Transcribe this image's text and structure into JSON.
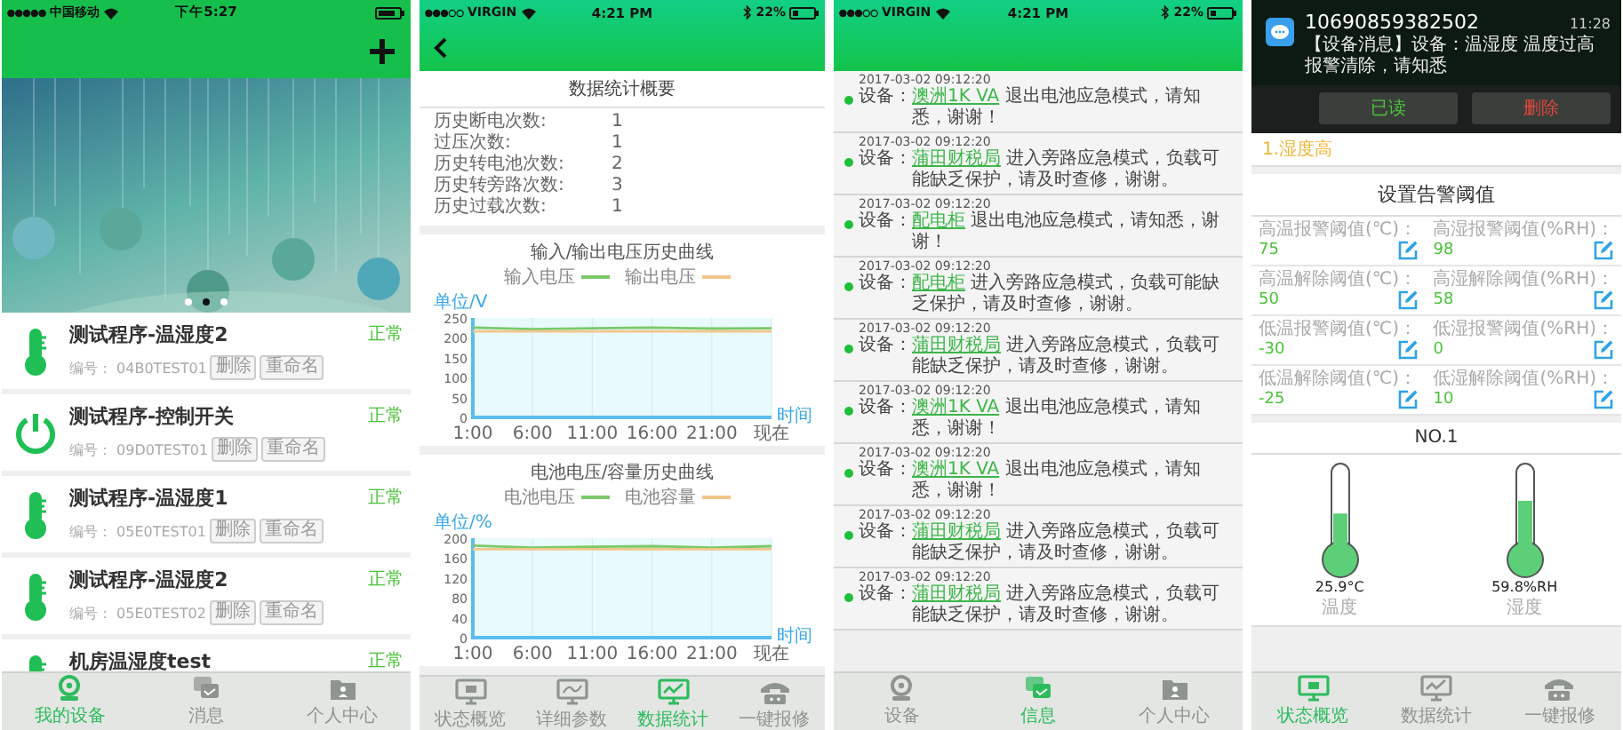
{
  "device_list_screen": {
    "status_bar": {
      "carrier": "中国移动",
      "time": "下午5:27"
    },
    "banner": {
      "dots": [
        {
          "selected": false
        },
        {
          "selected": true
        },
        {
          "selected": false
        }
      ]
    },
    "devices": [
      {
        "kind": "thermometer",
        "name": "测试程序-温湿度2",
        "code": "编号： 04B0TEST01",
        "actions": [
          "删除",
          "重命名"
        ],
        "status": "正常"
      },
      {
        "kind": "power",
        "name": "测试程序-控制开关",
        "code": "编号： 09D0TEST01",
        "actions": [
          "删除",
          "重命名"
        ],
        "status": "正常"
      },
      {
        "kind": "thermometer",
        "name": "测试程序-温湿度1",
        "code": "编号： 05E0TEST01",
        "actions": [
          "删除",
          "重命名"
        ],
        "status": "正常"
      },
      {
        "kind": "thermometer",
        "name": "测试程序-温湿度2",
        "code": "编号： 05E0TEST02",
        "actions": [
          "删除",
          "重命名"
        ],
        "status": "正常"
      },
      {
        "kind": "thermometer",
        "name": "机房温湿度test",
        "status": "正常"
      }
    ],
    "tabs": [
      {
        "kind": "webcam",
        "label": "我的设备",
        "selected": true
      },
      {
        "kind": "chat",
        "label": "消息",
        "selected": false
      },
      {
        "kind": "folder",
        "label": "个人中心",
        "selected": false
      }
    ]
  },
  "statistics_screen": {
    "status_bar": {
      "carrier": "VIRGIN",
      "time": "4:21 PM",
      "battery_percent": "22%"
    },
    "summary": {
      "title": "数据统计概要",
      "rows": [
        {
          "label": "历史断电次数:",
          "value": "1"
        },
        {
          "label": "过压次数:",
          "value": "1"
        },
        {
          "label": "历史转电池次数:",
          "value": "2"
        },
        {
          "label": "历史转旁路次数:",
          "value": "3"
        },
        {
          "label": "历史过载次数:",
          "value": "1"
        }
      ]
    },
    "charts": [
      {
        "chart_data": {
          "type": "line",
          "grid": true,
          "legend": "top",
          "title": "输入/输出电压历史曲线",
          "ylabel": "单位/V",
          "xlabel": "时间",
          "categories": [
            "1:00",
            "6:00",
            "11:00",
            "16:00",
            "21:00",
            "现在"
          ],
          "ylim": [
            0,
            250
          ],
          "yticks": [
            0,
            50,
            100,
            150,
            200,
            250
          ],
          "series": [
            {
              "name": "输入电压",
              "color": "#7cc96a",
              "values": [
                226,
                222,
                224,
                226,
                223,
                224
              ]
            },
            {
              "name": "输出电压",
              "color": "#f2c68a",
              "values": [
                216,
                216,
                216,
                216,
                216,
                216
              ]
            }
          ]
        }
      },
      {
        "chart_data": {
          "type": "line",
          "grid": true,
          "legend": "top",
          "title": "电池电压/容量历史曲线",
          "ylabel": "单位/%",
          "xlabel": "时间",
          "categories": [
            "1:00",
            "6:00",
            "11:00",
            "16:00",
            "21:00",
            "现在"
          ],
          "ylim": [
            0,
            200
          ],
          "yticks": [
            0,
            40,
            80,
            120,
            160,
            200
          ],
          "series": [
            {
              "name": "电池电压",
              "color": "#7cc96a",
              "values": [
                185,
                181,
                183,
                184,
                181,
                184
              ]
            },
            {
              "name": "电池容量",
              "color": "#f2c68a",
              "values": [
                178,
                178,
                178,
                178,
                178,
                178
              ]
            }
          ]
        }
      }
    ],
    "tabs": [
      {
        "kind": "monitor",
        "label": "状态概览",
        "selected": false
      },
      {
        "kind": "monitor-curve",
        "label": "详细参数",
        "selected": false
      },
      {
        "kind": "monitor-chart",
        "label": "数据统计",
        "selected": true
      },
      {
        "kind": "phone",
        "label": "一键报修",
        "selected": false
      }
    ]
  },
  "messages_screen": {
    "status_bar": {
      "carrier": "VIRGIN",
      "time": "4:21 PM",
      "battery_percent": "22%"
    },
    "messages": [
      {
        "time": "2017-03-02 09:12:20",
        "prefix": "设备：",
        "device": "澳洲1K VA",
        "text": " 退出电池应急模式，请知悉，谢谢！"
      },
      {
        "time": "2017-03-02 09:12:20",
        "prefix": "设备：",
        "device": "蒲田财税局",
        "text": " 进入旁路应急模式，负载可能缺乏保护，请及时查修，谢谢。"
      },
      {
        "time": "2017-03-02 09:12:20",
        "prefix": "设备：",
        "device": "配电柜",
        "text": " 退出电池应急模式，请知悉，谢谢！"
      },
      {
        "time": "2017-03-02 09:12:20",
        "prefix": "设备：",
        "device": "配电柜",
        "text": " 进入旁路应急模式，负载可能缺乏保护，请及时查修，谢谢。"
      },
      {
        "time": "2017-03-02 09:12:20",
        "prefix": "设备：",
        "device": "蒲田财税局",
        "text": " 进入旁路应急模式，负载可能缺乏保护，请及时查修，谢谢。"
      },
      {
        "time": "2017-03-02 09:12:20",
        "prefix": "设备：",
        "device": "澳洲1K VA",
        "text": " 退出电池应急模式，请知悉，谢谢！"
      },
      {
        "time": "2017-03-02 09:12:20",
        "prefix": "设备：",
        "device": "澳洲1K VA",
        "text": " 退出电池应急模式，请知悉，谢谢！"
      },
      {
        "time": "2017-03-02 09:12:20",
        "prefix": "设备：",
        "device": "蒲田财税局",
        "text": " 进入旁路应急模式，负载可能缺乏保护，请及时查修，谢谢。"
      },
      {
        "time": "2017-03-02 09:12:20",
        "prefix": "设备：",
        "device": "蒲田财税局",
        "text": " 进入旁路应急模式，负载可能缺乏保护，请及时查修，谢谢。"
      }
    ],
    "tabs": [
      {
        "kind": "webcam",
        "label": "设备",
        "selected": false
      },
      {
        "kind": "chat",
        "label": "信息",
        "selected": true
      },
      {
        "kind": "folder",
        "label": "个人中心",
        "selected": false
      }
    ]
  },
  "alarm_screen": {
    "notification": {
      "sender": "10690859382502",
      "time": "11:28",
      "text": "【设备消息】设备：温湿度 温度过高报警清除，请知悉",
      "actions": [
        {
          "kind": "read",
          "label": "已读"
        },
        {
          "kind": "delete",
          "label": "删除"
        }
      ]
    },
    "alarm": "1.湿度高",
    "thresholds_title": "设置告警阈值",
    "thresholds": [
      {
        "label": "高温报警阈值(℃)：",
        "value": "75"
      },
      {
        "label": "高湿报警阈值(%RH)：",
        "value": "98"
      },
      {
        "label": "高温解除阈值(℃)：",
        "value": "50"
      },
      {
        "label": "高湿解除阈值(%RH)：",
        "value": "58"
      },
      {
        "label": "低温报警阈值(℃)：",
        "value": "-30"
      },
      {
        "label": "低湿报警阈值(%RH)：",
        "value": "0"
      },
      {
        "label": "低温解除阈值(℃)：",
        "value": "-25"
      },
      {
        "label": "低湿解除阈值(%RH)：",
        "value": "10"
      }
    ],
    "device": "NO.1",
    "gauges": [
      {
        "level": 0.45,
        "reading": "25.9°C",
        "label": "温度"
      },
      {
        "level": 0.62,
        "reading": "59.8%RH",
        "label": "湿度"
      }
    ],
    "tabs": [
      {
        "kind": "monitor",
        "label": "状态概览",
        "selected": true
      },
      {
        "kind": "monitor-chart",
        "label": "数据统计",
        "selected": false
      },
      {
        "kind": "phone",
        "label": "一键报修",
        "selected": false
      }
    ]
  }
}
